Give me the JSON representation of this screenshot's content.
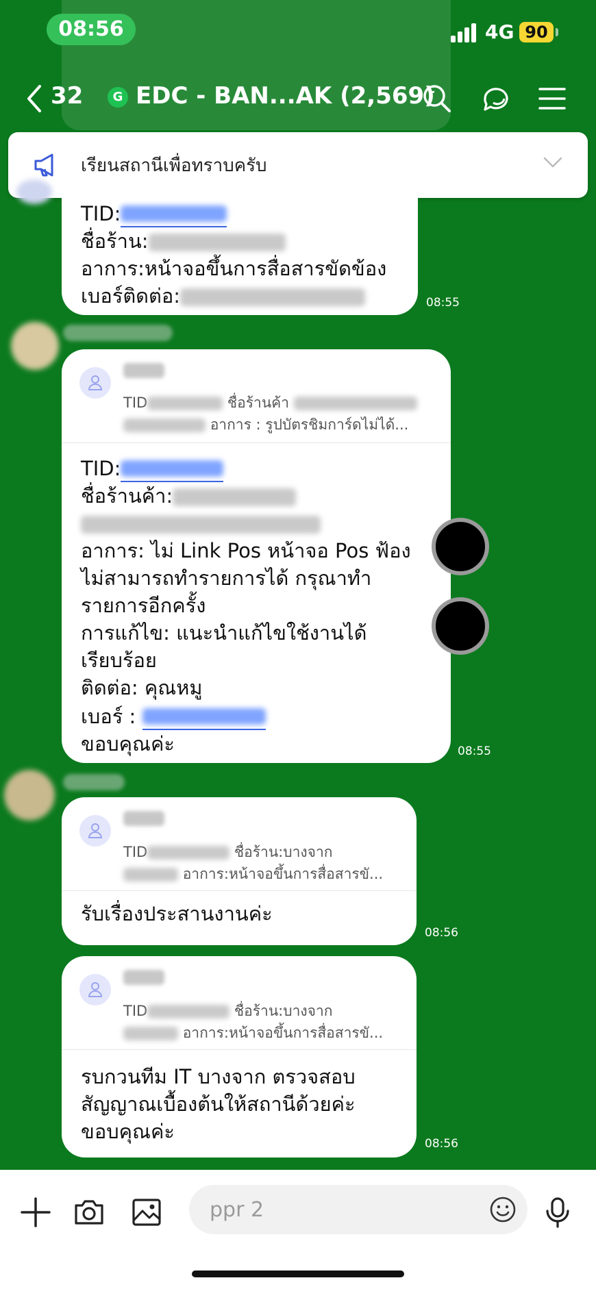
{
  "status_bar": {
    "time": "08:56",
    "network": "4G",
    "battery": "90"
  },
  "header": {
    "back_count": "32",
    "group_badge": "G",
    "title": "EDC - BAN...AK (2,569)"
  },
  "announcement": {
    "text": "เรียนสถานีเพื่อทราบครับ"
  },
  "messages": [
    {
      "lines": [
        "TID:",
        "ชื่อร้าน:",
        "อาการ:หน้าจอขึ้นการสื่อสารขัดข้อง",
        "เบอร์ติดต่อ:"
      ],
      "time": "08:55"
    },
    {
      "quote": {
        "line1_prefix": "TID",
        "line1_mid": "ชื่อร้านค้า",
        "line2": "อาการ : รูปบัตรชิมการ์ดไม่ได้..."
      },
      "lines": [
        "TID:",
        "ชื่อร้านค้า:",
        "อาการ: ไม่ Link Pos หน้าจอ Pos ฟ้อง",
        "ไม่สามารถทำรายการได้ กรุณาทำ",
        "รายการอีกครั้ง",
        "การแก้ไข: แนะนำแก้ไขใช้งานได้",
        "เรียบร้อย",
        "ติดต่อ: คุณหมู",
        "เบอร์ :",
        "ขอบคุณค่ะ"
      ],
      "time": "08:55"
    },
    {
      "quote": {
        "line1_prefix": "TID",
        "line1_mid": "ชื่อร้าน:บางจาก",
        "line2": "อาการ:หน้าจอขึ้นการสื่อสารขั..."
      },
      "lines": [
        "รับเรื่องประสานงานค่ะ"
      ],
      "time": "08:56"
    },
    {
      "quote": {
        "line1_prefix": "TID",
        "line1_mid": "ชื่อร้าน:บางจาก",
        "line2": "อาการ:หน้าจอขึ้นการสื่อสารขั..."
      },
      "lines": [
        "รบกวนทีม IT บางจาก ตรวจสอบ",
        "สัญญาณเบื้องต้นให้สถานีด้วยค่ะ",
        "ขอบคุณค่ะ"
      ],
      "time": "08:56"
    }
  ],
  "input": {
    "value": "ppr 2"
  },
  "icons": [
    "back-icon",
    "search-icon",
    "chat-icon",
    "menu-icon",
    "megaphone-icon",
    "chevron-down-icon",
    "plus-icon",
    "camera-icon",
    "image-icon",
    "emoji-icon",
    "mic-icon",
    "user-icon"
  ],
  "colors": {
    "chat_bg": "#0b7a1e",
    "time_pill": "#35c05a",
    "battery": "#f6d733",
    "link": "#3b63e0"
  }
}
